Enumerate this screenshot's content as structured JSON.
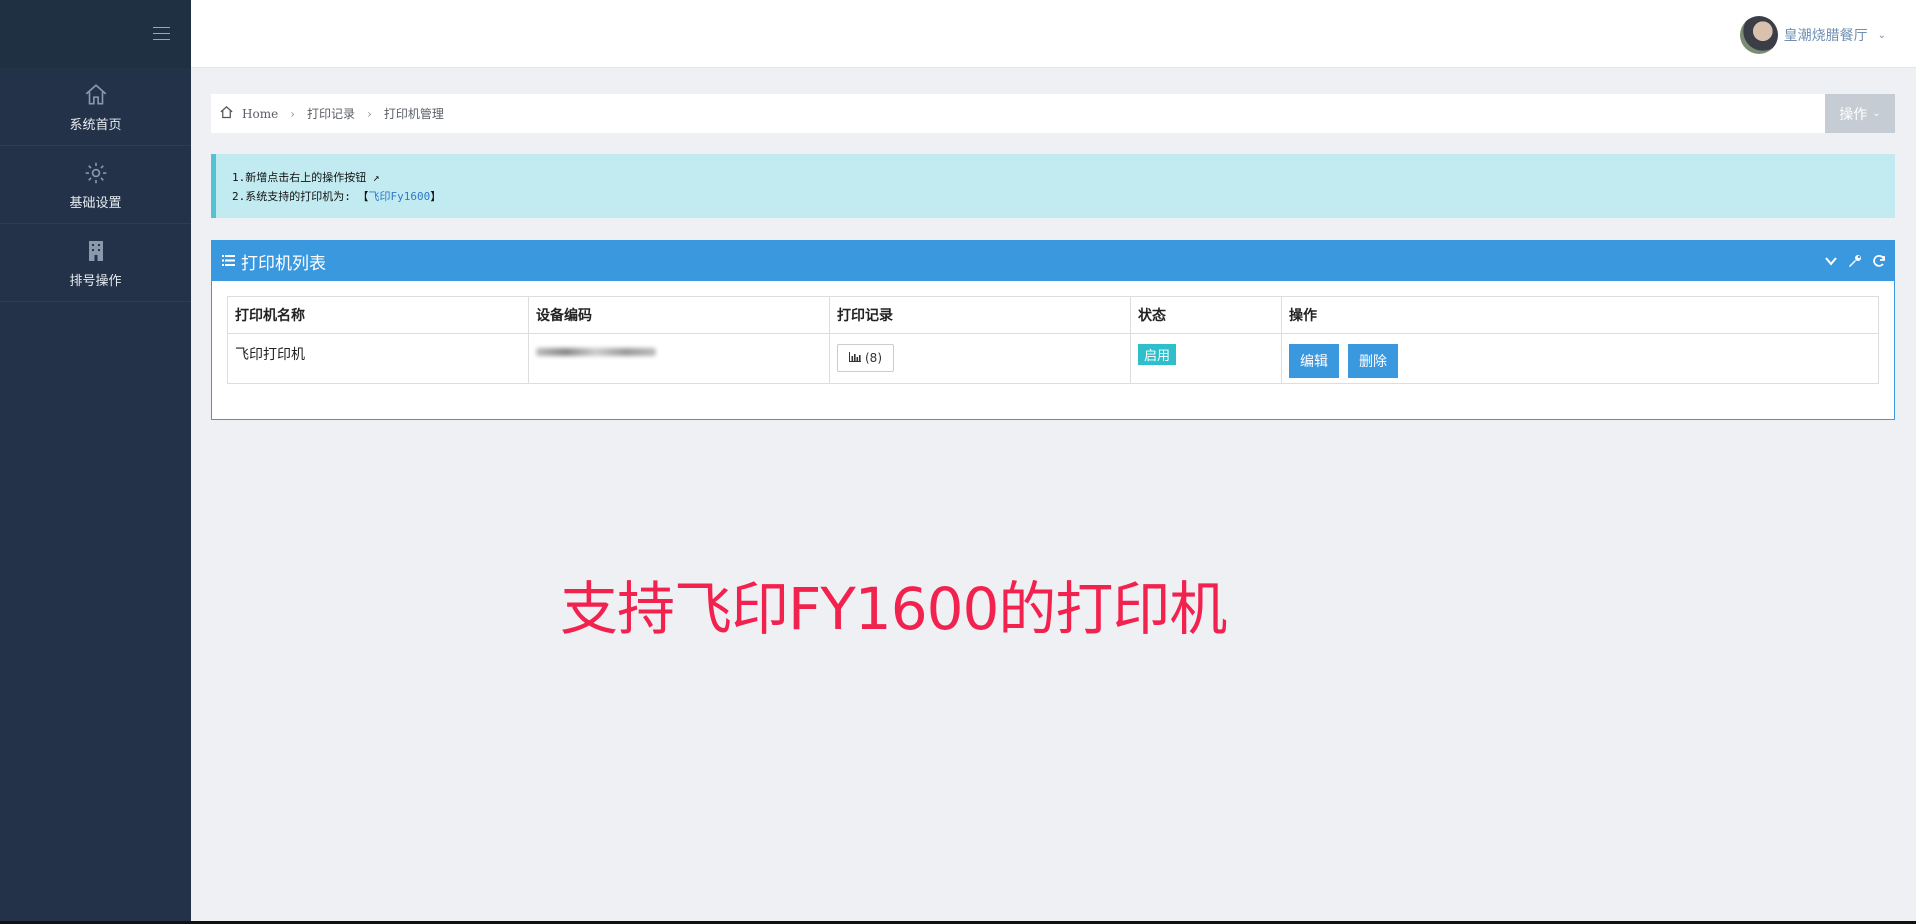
{
  "sidebar": {
    "items": [
      {
        "label": "系统首页",
        "icon": "home-icon"
      },
      {
        "label": "基础设置",
        "icon": "gear-icon"
      },
      {
        "label": "排号操作",
        "icon": "building-icon"
      }
    ]
  },
  "header": {
    "user_name": "皇潮烧腊餐厅"
  },
  "breadcrumb": {
    "items": [
      "Home",
      "打印记录",
      "打印机管理"
    ],
    "ops_label": "操作"
  },
  "alert": {
    "line1": "1.新增点击右上的操作按钮 ↗",
    "line2_prefix": "2.系统支持的打印机为: 【",
    "line2_link": "飞印Fy1600",
    "line2_suffix": "】"
  },
  "panel": {
    "title": "打印机列表",
    "columns": [
      "打印机名称",
      "设备编码",
      "打印记录",
      "状态",
      "操作"
    ],
    "rows": [
      {
        "name": "飞印打印机",
        "record_count": "(8)",
        "status": "启用",
        "edit_label": "编辑",
        "delete_label": "删除"
      }
    ]
  },
  "caption": "支持飞印FY1600的打印机",
  "colors": {
    "sidebar": "#233249",
    "accent": "#3a98df",
    "alert_bg": "#c1ebf0",
    "status": "#2fbfcb",
    "caption": "#f2224f"
  }
}
